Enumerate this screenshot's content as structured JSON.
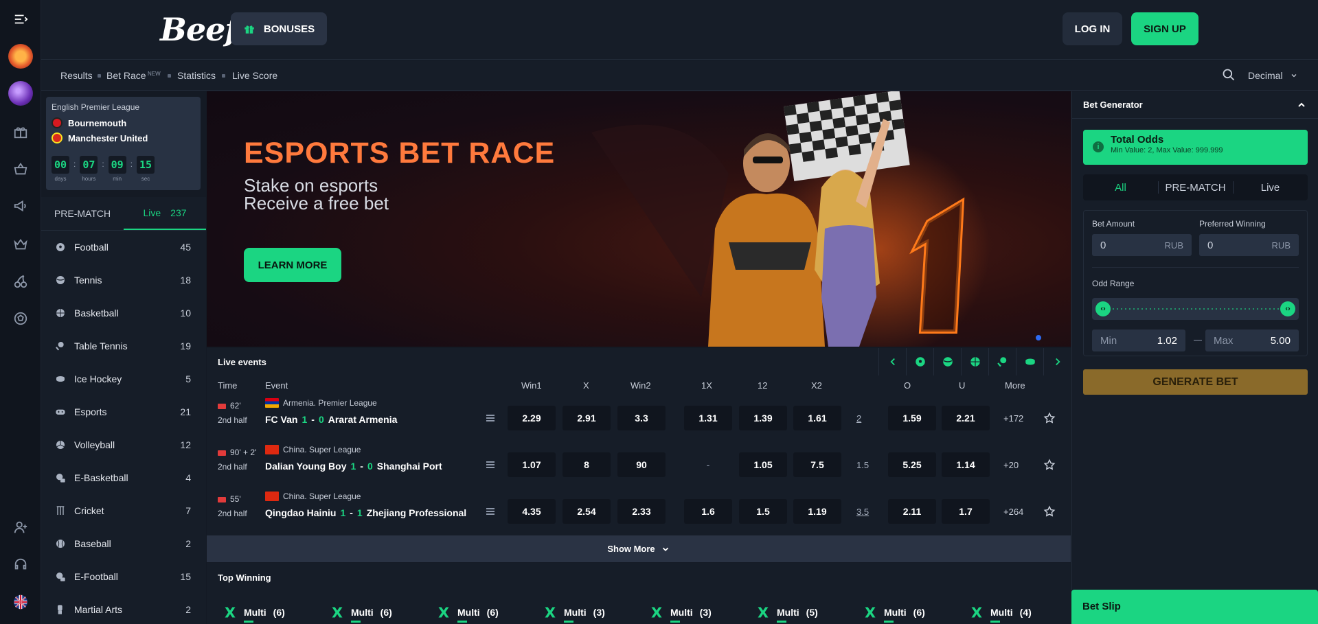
{
  "header": {
    "logo": "Beef",
    "bonuses_label": "BONUSES",
    "login_label": "LOG IN",
    "signup_label": "SIGN UP"
  },
  "subnav": {
    "links": [
      "Results",
      "Bet Race",
      "Statistics",
      "Live Score"
    ],
    "new_tag": "NEW",
    "odds_format": "Decimal"
  },
  "match_widget": {
    "league": "English Premier League",
    "home": "Bournemouth",
    "away": "Manchester United",
    "countdown": [
      {
        "value": "00",
        "label": "days"
      },
      {
        "value": "07",
        "label": "hours"
      },
      {
        "value": "09",
        "label": "min"
      },
      {
        "value": "15",
        "label": "sec"
      }
    ]
  },
  "sports_tabs": {
    "prematch": "PRE-MATCH",
    "live": "Live",
    "live_count": "237"
  },
  "sports": [
    {
      "name": "Football",
      "count": "45",
      "icon": "football-icon"
    },
    {
      "name": "Tennis",
      "count": "18",
      "icon": "tennis-icon"
    },
    {
      "name": "Basketball",
      "count": "10",
      "icon": "basketball-icon"
    },
    {
      "name": "Table Tennis",
      "count": "19",
      "icon": "table-tennis-icon"
    },
    {
      "name": "Ice Hockey",
      "count": "5",
      "icon": "ice-hockey-icon"
    },
    {
      "name": "Esports",
      "count": "21",
      "icon": "gamepad-icon"
    },
    {
      "name": "Volleyball",
      "count": "12",
      "icon": "volleyball-icon"
    },
    {
      "name": "E-Basketball",
      "count": "4",
      "icon": "e-basketball-icon"
    },
    {
      "name": "Cricket",
      "count": "7",
      "icon": "cricket-icon"
    },
    {
      "name": "Baseball",
      "count": "2",
      "icon": "baseball-icon"
    },
    {
      "name": "E-Football",
      "count": "15",
      "icon": "e-football-icon"
    },
    {
      "name": "Martial Arts",
      "count": "2",
      "icon": "martial-arts-icon"
    }
  ],
  "banner": {
    "title": "ESPORTS BET RACE",
    "subtitle_1": "Stake on esports",
    "subtitle_2": "Receive a free bet",
    "cta": "LEARN MORE"
  },
  "live_events": {
    "title": "Live events",
    "columns": {
      "time": "Time",
      "event": "Event",
      "win1": "Win1",
      "x": "X",
      "win2": "Win2",
      "x1": "1X",
      "c12": "12",
      "x2": "X2",
      "o": "O",
      "u": "U",
      "more": "More"
    },
    "rows": [
      {
        "minute": "62'",
        "period": "2nd half",
        "league": "Armenia. Premier League",
        "home": "FC Van",
        "home_score": "1",
        "dash": "-",
        "away_score": "0",
        "away": "Ararat Armenia",
        "win1": "2.29",
        "x": "2.91",
        "win2": "3.3",
        "x1": "1.31",
        "c12": "1.39",
        "x2": "1.61",
        "total": "2",
        "o": "1.59",
        "u": "2.21",
        "more": "+172"
      },
      {
        "minute": "90' + 2'",
        "period": "2nd half",
        "league": "China. Super League",
        "home": "Dalian Young Boy",
        "home_score": "1",
        "dash": "-",
        "away_score": "0",
        "away": "Shanghai Port",
        "win1": "1.07",
        "x": "8",
        "win2": "90",
        "x1": "-",
        "c12": "1.05",
        "x2": "7.5",
        "total": "1.5",
        "o": "5.25",
        "u": "1.14",
        "more": "+20"
      },
      {
        "minute": "55'",
        "period": "2nd half",
        "league": "China. Super League",
        "home": "Qingdao Hainiu",
        "home_score": "1",
        "dash": "-",
        "away_score": "1",
        "away": "Zhejiang Professional",
        "win1": "4.35",
        "x": "2.54",
        "win2": "2.33",
        "x1": "1.6",
        "c12": "1.5",
        "x2": "1.19",
        "total": "3.5",
        "o": "2.11",
        "u": "1.7",
        "more": "+264"
      }
    ],
    "show_more": "Show More"
  },
  "top_winning": {
    "title": "Top Winning",
    "items": [
      {
        "label": "Multi",
        "count": "(6)"
      },
      {
        "label": "Multi",
        "count": "(6)"
      },
      {
        "label": "Multi",
        "count": "(6)"
      },
      {
        "label": "Multi",
        "count": "(3)"
      },
      {
        "label": "Multi",
        "count": "(3)"
      },
      {
        "label": "Multi",
        "count": "(5)"
      },
      {
        "label": "Multi",
        "count": "(6)"
      },
      {
        "label": "Multi",
        "count": "(4)"
      }
    ]
  },
  "bet_generator": {
    "title": "Bet Generator",
    "total_odds": "Total Odds",
    "total_odds_sub": "Min Value: 2, Max Value: 999.999",
    "tabs": [
      "All",
      "PRE-MATCH",
      "Live"
    ],
    "bet_amount_label": "Bet Amount",
    "bet_amount_value": "0",
    "preferred_label": "Preferred Winning",
    "preferred_value": "0",
    "currency": "RUB",
    "odd_range_label": "Odd Range",
    "min_label": "Min",
    "min_value": "1.02",
    "max_label": "Max",
    "max_value": "5.00",
    "generate": "GENERATE BET"
  },
  "bet_slip": "Bet Slip",
  "colors": {
    "accent": "#1bd582",
    "banner_title": "#ff7a3d",
    "background": "#141a24",
    "generate_button": "#8a6a2a"
  }
}
